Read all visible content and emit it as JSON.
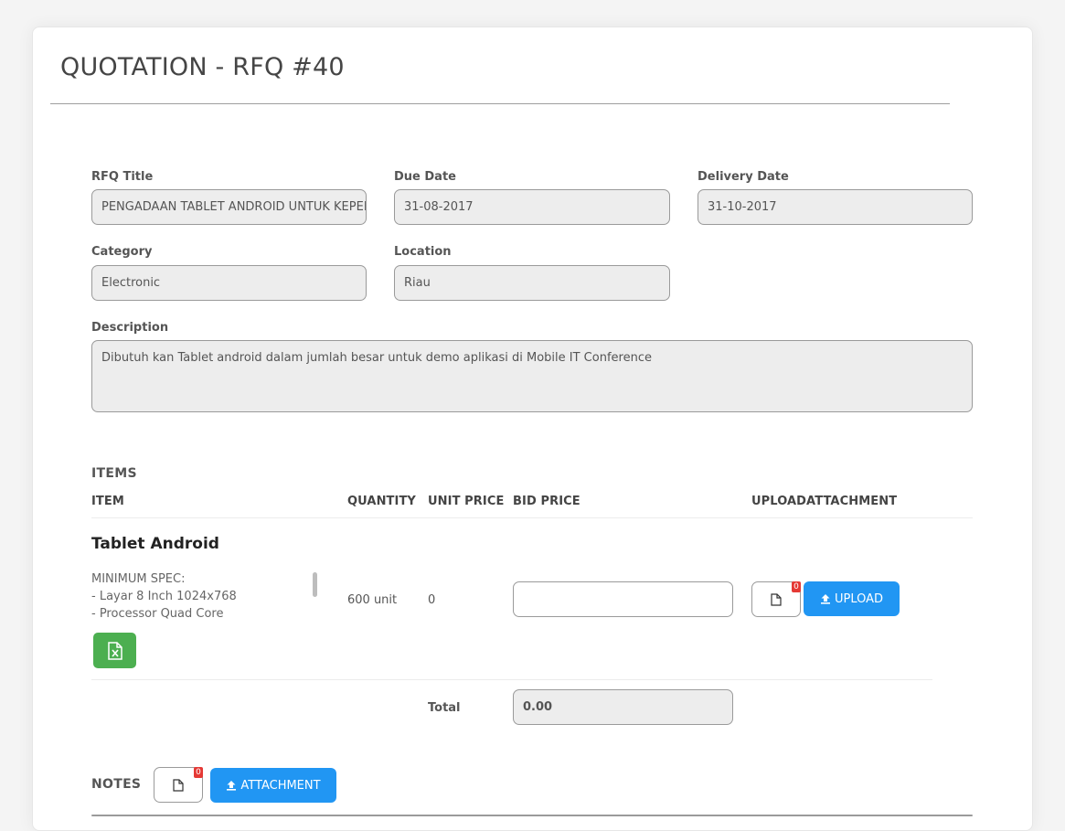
{
  "page": {
    "title": "QUOTATION - RFQ #40"
  },
  "form": {
    "rfq_title": {
      "label": "RFQ Title",
      "value": "PENGADAAN TABLET ANDROID UNTUK KEPERI"
    },
    "due_date": {
      "label": "Due Date",
      "value": "31-08-2017"
    },
    "delivery_date": {
      "label": "Delivery Date",
      "value": "31-10-2017"
    },
    "category": {
      "label": "Category",
      "value": "Electronic"
    },
    "location": {
      "label": "Location",
      "value": "Riau"
    },
    "description": {
      "label": "Description",
      "value": "Dibutuh kan Tablet android dalam jumlah besar untuk demo aplikasi di Mobile IT Conference"
    }
  },
  "items": {
    "section_title": "ITEMS",
    "columns": {
      "item": "ITEM",
      "quantity": "QUANTITY",
      "unit_price": "UNIT PRICE",
      "bid_price": "BID PRICE",
      "upload_attachment": "UPLOADATTACHMENT"
    },
    "rows": [
      {
        "name": "Tablet Android",
        "spec": "MINIMUM SPEC:\n- Layar 8 Inch 1024x768\n- Processor Quad Core",
        "quantity": "600 unit",
        "unit_price": "0",
        "bid_price": "",
        "attachment_count": "0",
        "upload_label": "UPLOAD"
      }
    ],
    "total_label": "Total",
    "total_value": "0.00"
  },
  "notes": {
    "section_title": "NOTES",
    "attachment_count": "0",
    "attachment_label": "ATTACHMENT"
  },
  "colors": {
    "primary_button": "#2196f3",
    "excel_button": "#4caf50",
    "badge": "#e53935"
  }
}
